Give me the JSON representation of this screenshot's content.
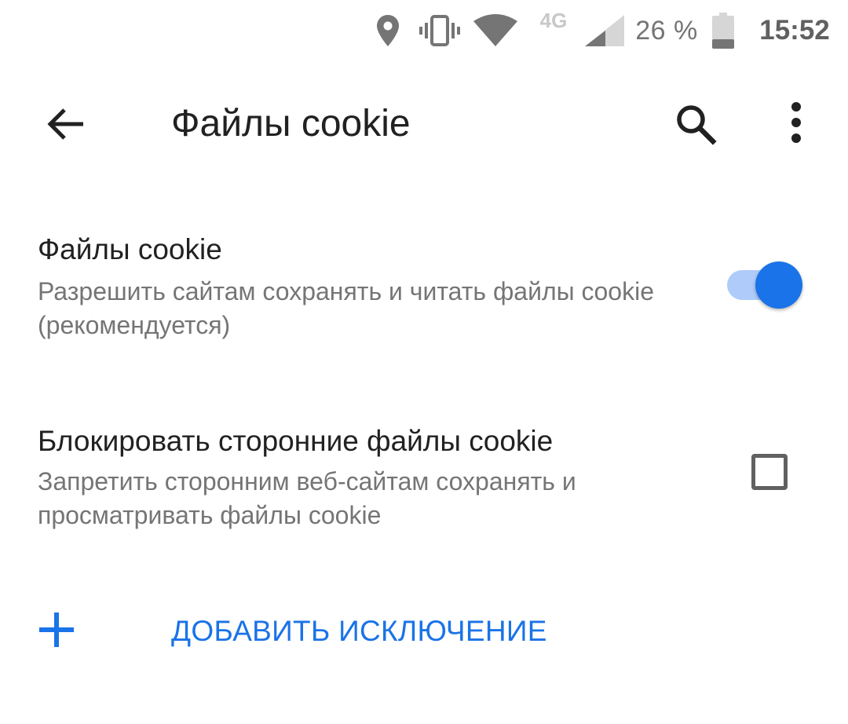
{
  "status_bar": {
    "network_type": "4G",
    "battery_percent": "26 %",
    "time": "15:52",
    "icons": [
      "location-icon",
      "vibrate-icon",
      "wifi-icon",
      "cellular-signal-icon",
      "battery-icon"
    ]
  },
  "app_bar": {
    "title": "Файлы cookie",
    "icons": [
      "back-arrow-icon",
      "search-icon",
      "more-vert-icon"
    ]
  },
  "settings": {
    "cookies": {
      "title": "Файлы cookie",
      "summary": "Разрешить сайтам сохранять и читать файлы cookie (рекомендуется)",
      "enabled": true
    },
    "block_third_party": {
      "title": "Блокировать сторонние файлы cookie",
      "summary": "Запретить сторонним веб-сайтам сохранять и просматривать файлы cookie",
      "checked": false
    }
  },
  "add_exception": {
    "label": "ДОБАВИТЬ ИСКЛЮЧЕНИЕ",
    "icon": "plus-icon"
  },
  "colors": {
    "accent": "#1a73e8",
    "accent_light": "#aecbfa",
    "text_primary": "#212121",
    "text_secondary": "#757575"
  }
}
